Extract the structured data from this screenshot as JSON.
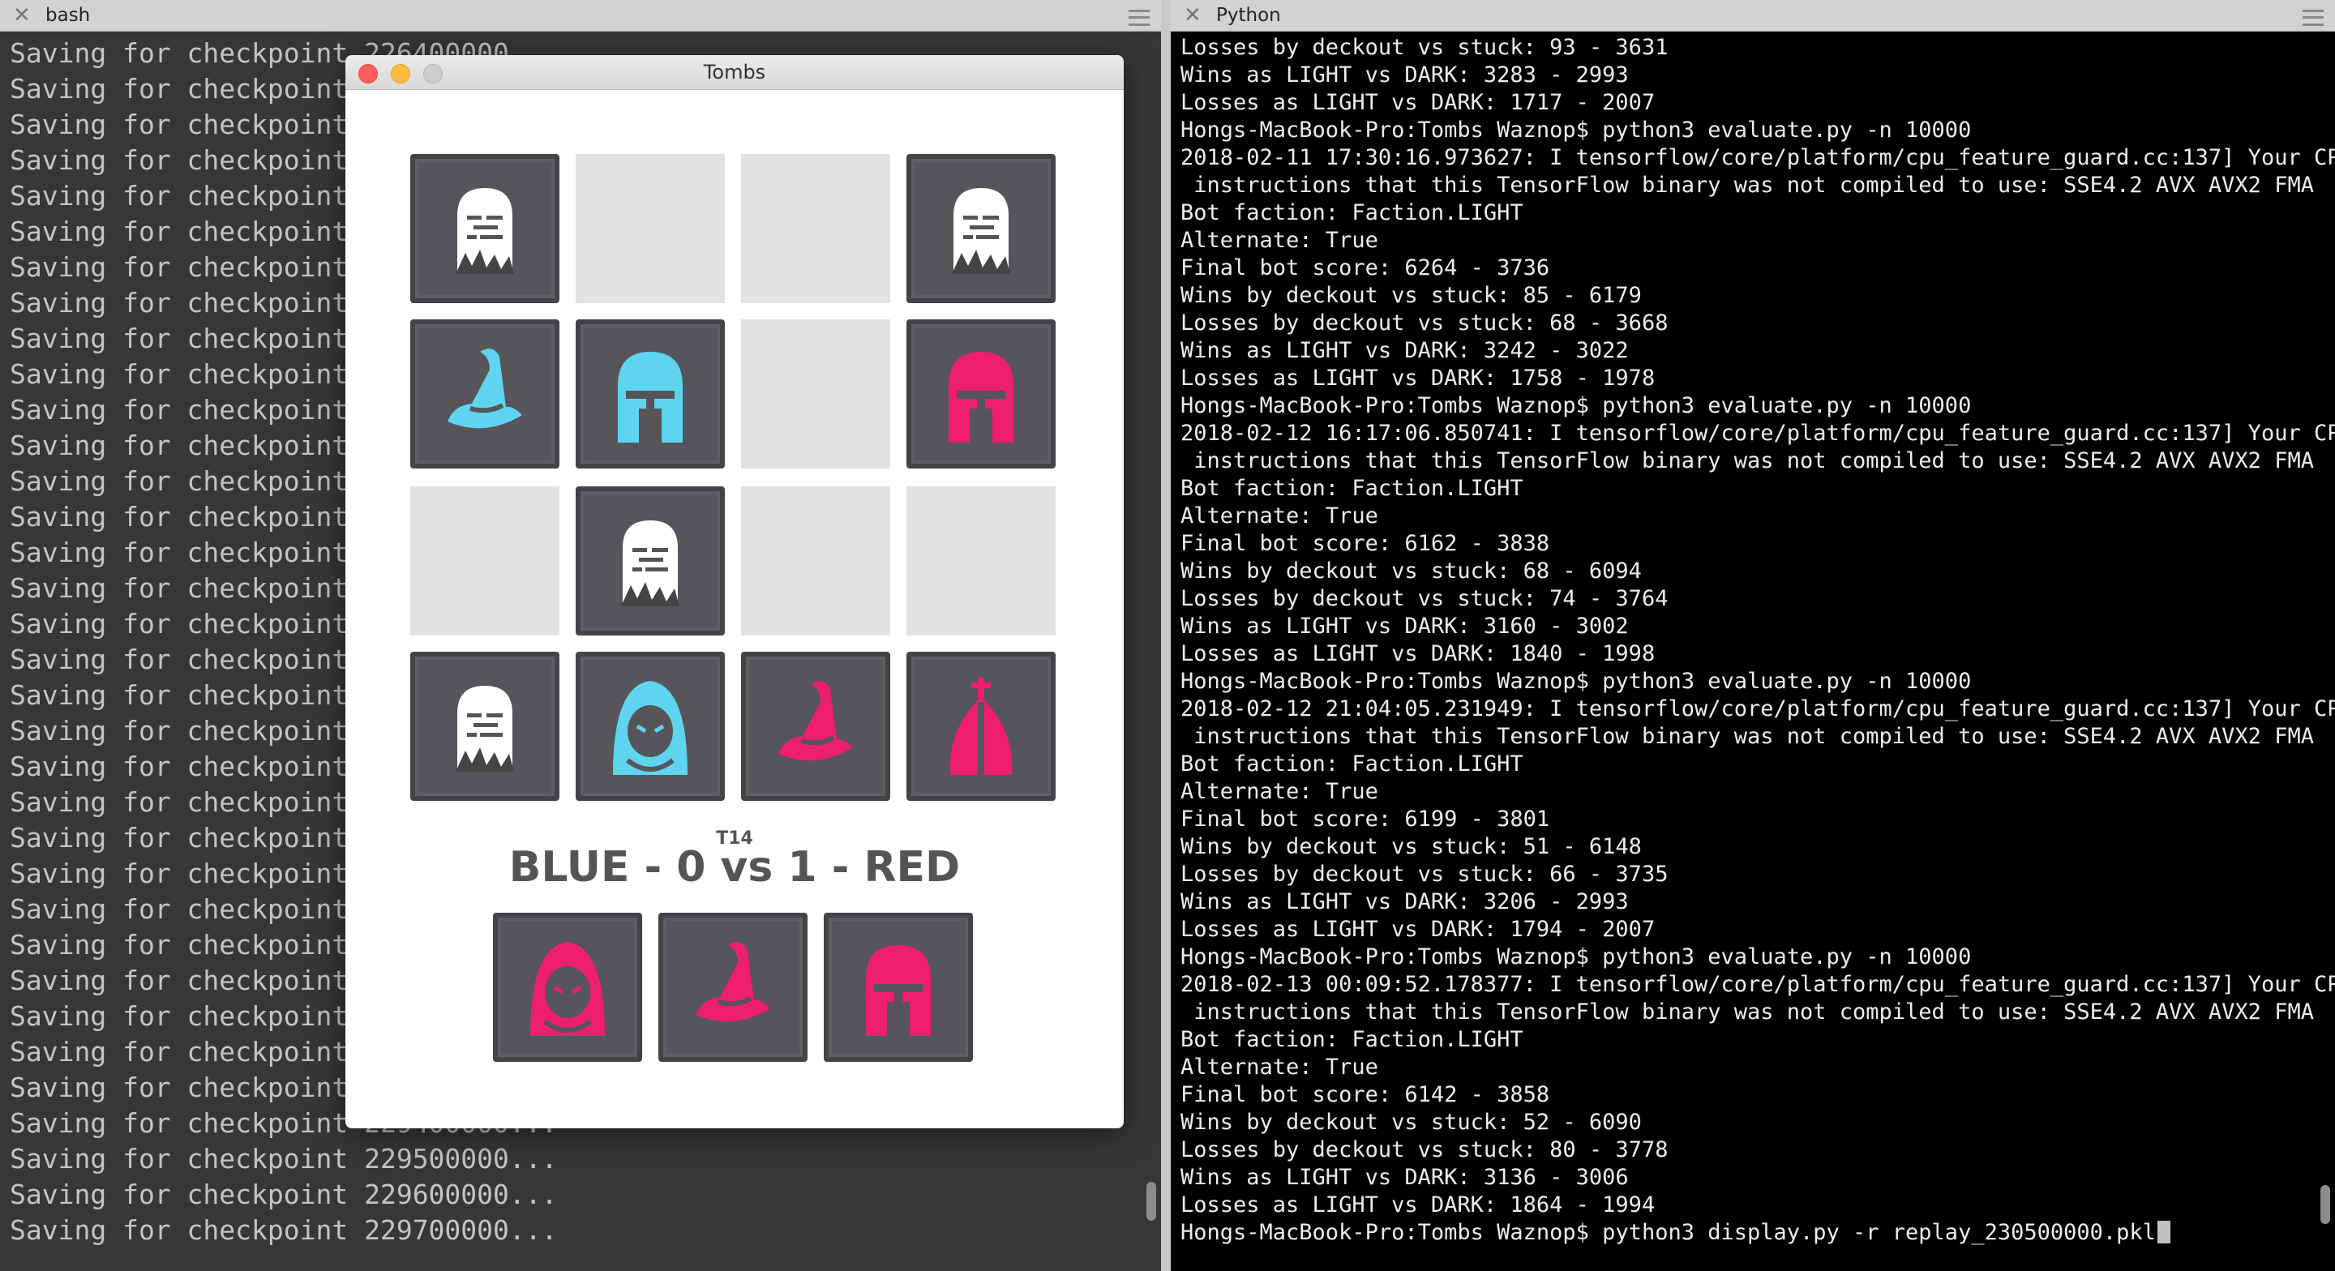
{
  "left_tab": {
    "title": "bash"
  },
  "right_tab": {
    "title": "Python"
  },
  "bash_lines": [
    "Saving for checkpoint 226400000...",
    "Saving for checkpoint 226500000...",
    "Saving for checkpoint 226600000...",
    "Saving for checkpoint 226700000...",
    "Saving for checkpoint 226800000...",
    "Saving for checkpoint 226900000...",
    "Saving for checkpoint 227000000...",
    "Saving for checkpoint 227100000...",
    "Saving for checkpoint 227200000...",
    "Saving for checkpoint 227300000...",
    "Saving for checkpoint 227400000...",
    "Saving for checkpoint 227500000...",
    "Saving for checkpoint 227600000...",
    "Saving for checkpoint 227700000...",
    "Saving for checkpoint 227800000...",
    "Saving for checkpoint 227900000...",
    "Saving for checkpoint 228000000...",
    "Saving for checkpoint 228100000...",
    "Saving for checkpoint 228200000...",
    "Saving for checkpoint 228300000...",
    "Saving for checkpoint 228400000...",
    "Saving for checkpoint 228500000...",
    "Saving for checkpoint 228600000...",
    "Saving for checkpoint 228700000...",
    "Saving for checkpoint 228800000...",
    "Saving for checkpoint 228900000...",
    "Saving for checkpoint 229000000...",
    "Saving for checkpoint 229100000...",
    "Saving for checkpoint 229200000...",
    "Saving for checkpoint 229300000...",
    "Saving for checkpoint 229400000...",
    "Saving for checkpoint 229500000...",
    "Saving for checkpoint 229600000...",
    "Saving for checkpoint 229700000..."
  ],
  "python_lines": [
    "Losses by deckout vs stuck: 93 - 3631",
    "Wins as LIGHT vs DARK: 3283 - 2993",
    "Losses as LIGHT vs DARK: 1717 - 2007",
    "Hongs-MacBook-Pro:Tombs Waznop$ python3 evaluate.py -n 10000",
    "2018-02-11 17:30:16.973627: I tensorflow/core/platform/cpu_feature_guard.cc:137] Your CPU supports",
    " instructions that this TensorFlow binary was not compiled to use: SSE4.2 AVX AVX2 FMA",
    "Bot faction: Faction.LIGHT",
    "Alternate: True",
    "Final bot score: 6264 - 3736",
    "Wins by deckout vs stuck: 85 - 6179",
    "Losses by deckout vs stuck: 68 - 3668",
    "Wins as LIGHT vs DARK: 3242 - 3022",
    "Losses as LIGHT vs DARK: 1758 - 1978",
    "Hongs-MacBook-Pro:Tombs Waznop$ python3 evaluate.py -n 10000",
    "2018-02-12 16:17:06.850741: I tensorflow/core/platform/cpu_feature_guard.cc:137] Your CPU supports",
    " instructions that this TensorFlow binary was not compiled to use: SSE4.2 AVX AVX2 FMA",
    "Bot faction: Faction.LIGHT",
    "Alternate: True",
    "Final bot score: 6162 - 3838",
    "Wins by deckout vs stuck: 68 - 6094",
    "Losses by deckout vs stuck: 74 - 3764",
    "Wins as LIGHT vs DARK: 3160 - 3002",
    "Losses as LIGHT vs DARK: 1840 - 1998",
    "Hongs-MacBook-Pro:Tombs Waznop$ python3 evaluate.py -n 10000",
    "2018-02-12 21:04:05.231949: I tensorflow/core/platform/cpu_feature_guard.cc:137] Your CPU supports",
    " instructions that this TensorFlow binary was not compiled to use: SSE4.2 AVX AVX2 FMA",
    "Bot faction: Faction.LIGHT",
    "Alternate: True",
    "Final bot score: 6199 - 3801",
    "Wins by deckout vs stuck: 51 - 6148",
    "Losses by deckout vs stuck: 66 - 3735",
    "Wins as LIGHT vs DARK: 3206 - 2993",
    "Losses as LIGHT vs DARK: 1794 - 2007",
    "Hongs-MacBook-Pro:Tombs Waznop$ python3 evaluate.py -n 10000",
    "2018-02-13 00:09:52.178377: I tensorflow/core/platform/cpu_feature_guard.cc:137] Your CPU supports",
    " instructions that this TensorFlow binary was not compiled to use: SSE4.2 AVX AVX2 FMA",
    "Bot faction: Faction.LIGHT",
    "Alternate: True",
    "Final bot score: 6142 - 3858",
    "Wins by deckout vs stuck: 52 - 6090",
    "Losses by deckout vs stuck: 80 - 3778",
    "Wins as LIGHT vs DARK: 3136 - 3006",
    "Losses as LIGHT vs DARK: 1864 - 1994",
    "Hongs-MacBook-Pro:Tombs Waznop$ python3 display.py -r replay_230500000.pkl"
  ],
  "game": {
    "window_title": "Tombs",
    "turn": "T14",
    "score": "BLUE - 0 vs 1 - RED",
    "colors": {
      "blue": "#5fd4f0",
      "red": "#ee1f6b",
      "tomb": "#ffffff"
    },
    "board": [
      [
        "tombstone-icon",
        "empty",
        "empty",
        "tombstone-icon"
      ],
      [
        "blue-wizard-hat-icon",
        "blue-helmet-icon",
        "empty",
        "red-helmet-icon"
      ],
      [
        "empty",
        "tombstone-icon",
        "empty",
        "empty"
      ],
      [
        "tombstone-icon",
        "blue-hood-icon",
        "red-wizard-hat-icon",
        "red-mitre-icon"
      ]
    ],
    "hand": [
      "red-hood-icon",
      "red-wizard-hat-icon",
      "red-helmet-icon"
    ]
  }
}
